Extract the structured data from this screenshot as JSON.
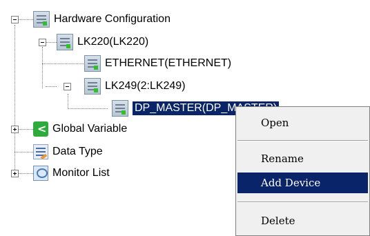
{
  "tree": {
    "hardware_configuration": "Hardware Configuration",
    "lk220": "LK220(LK220)",
    "ethernet": "ETHERNET(ETHERNET)",
    "lk249": "LK249(2:LK249)",
    "dp_master": "DP_MASTER(DP_MASTER)",
    "global_variable": "Global Variable",
    "data_type": "Data Type",
    "monitor_list": "Monitor List"
  },
  "context_menu": {
    "open": "Open",
    "rename": "Rename",
    "add_device": "Add Device",
    "delete": "Delete"
  },
  "colors": {
    "selection": "#0a246a",
    "menu_bg": "#f0f0f0"
  },
  "icons": {
    "hardware": "hardware-icon",
    "global_variable": "global-variable-icon",
    "data_type": "data-type-icon",
    "monitor_list": "monitor-list-icon"
  }
}
